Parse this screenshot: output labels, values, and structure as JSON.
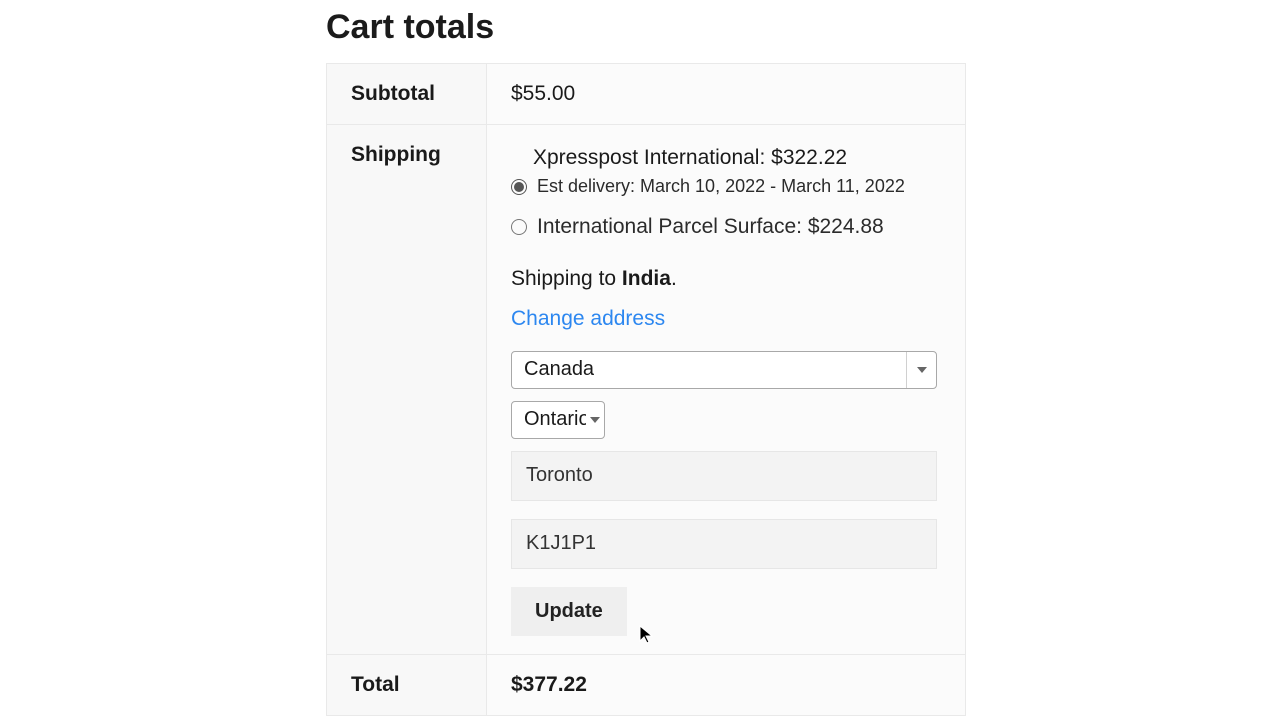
{
  "title": "Cart totals",
  "rows": {
    "subtotal": {
      "label": "Subtotal",
      "value": "$55.00"
    },
    "shipping": {
      "label": "Shipping",
      "options": [
        {
          "name_label": "Xpresspost International: $322.22",
          "sub_label": "Est delivery: March 10, 2022 - March 11, 2022",
          "selected": true
        },
        {
          "name_label": "International Parcel Surface: $224.88",
          "sub_label": "",
          "selected": false
        }
      ],
      "shipping_to_prefix": "Shipping to ",
      "shipping_to_dest": "India",
      "shipping_to_suffix": ".",
      "change_addr": "Change address",
      "form": {
        "country": "Canada",
        "province": "Ontario",
        "city": "Toronto",
        "postal": "K1J1P1",
        "update_label": "Update"
      }
    },
    "total": {
      "label": "Total",
      "value": "$377.22"
    }
  }
}
